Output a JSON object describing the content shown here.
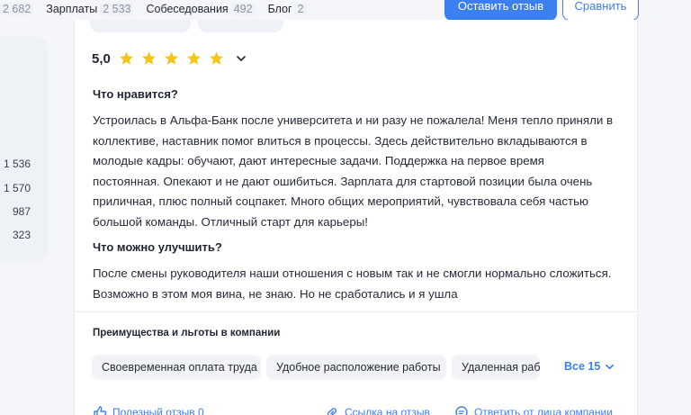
{
  "topnav": {
    "items": [
      {
        "label": "",
        "count": "2 682"
      },
      {
        "label": "Зарплаты",
        "count": "2 533"
      },
      {
        "label": "Собеседования",
        "count": "492"
      },
      {
        "label": "Блог",
        "count": "2"
      }
    ],
    "leave_review_button": "Оставить отзыв",
    "compare_button": "Сравнить"
  },
  "sidebar": {
    "counts": [
      "1 536",
      "1 570",
      "987",
      "323"
    ]
  },
  "review": {
    "rating": "5,0",
    "stars": 5,
    "likes_title": "Что нравится?",
    "likes_text": "Устроилась в Альфа-Банк после университета и ни разу не пожалела! Меня тепло приняли в коллективе, наставник помог влиться в процессы. Здесь действительно вкладываются в молодые кадры: обучают, дают интересные задачи. Поддержка на первое время постоянная. Опекают и не дают ошибиться. Зарплата для стартовой позиции была очень приличная, плюс полный соцпакет. Много общих мероприятий, чувствовала себя частью большой команды. Отличный старт для карьеры!",
    "improve_title": "Что можно улучшить?",
    "improve_text": "После смены руководителя наши отношения с новым так и не смогли нормально сложиться. Возможно в этом моя вина, не знаю. Но не сработались и я ушла",
    "benefits_title": "Преимущества и льготы в компании",
    "benefits": [
      "Своевременная оплата труда",
      "Удобное расположение работы",
      "Удаленная работа"
    ],
    "benefits_more": "Все 15",
    "footer": {
      "helpful": "Полезный отзыв 0",
      "link": "Ссылка на отзыв",
      "reply": "Ответить от лица компании"
    }
  },
  "colors": {
    "accent": "#3c7ff0",
    "star": "#f5c518",
    "chip_bg": "#f1f3f6"
  }
}
